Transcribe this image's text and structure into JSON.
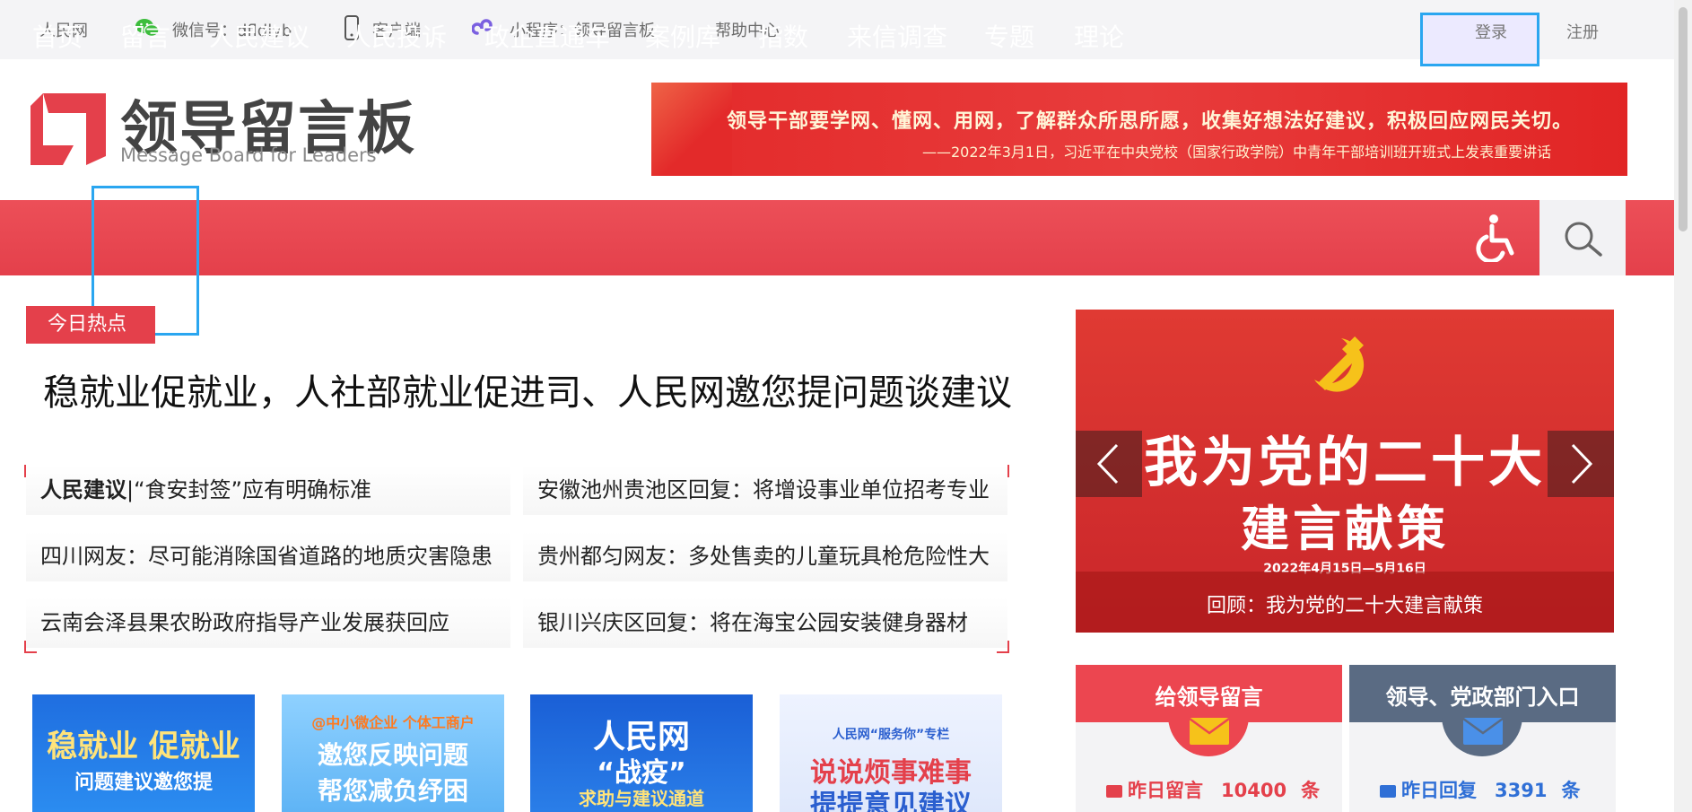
{
  "topbar": {
    "site": "人民网",
    "wechat": "微信号：dfldlyb",
    "client": "客户端",
    "miniprogram": "小程序：领导留言板",
    "help": "帮助中心",
    "login": "登录",
    "register": "注册"
  },
  "logo": {
    "cn": "领导留言板",
    "en": "Message Board for Leaders"
  },
  "banner": {
    "line1": "领导干部要学网、懂网、用网，了解群众所思所愿，收集好想法好建议，积极回应网民关切。",
    "line2": "——2022年3月1日，习近平在中央党校（国家行政学院）中青年干部培训班开班式上发表重要讲话"
  },
  "nav": {
    "items": [
      "首页",
      "留言",
      "人民建议",
      "人民投诉",
      "政企直通车",
      "案例库",
      "指数",
      "来信调查",
      "专题",
      "理论"
    ]
  },
  "hot": {
    "tag": "今日热点",
    "headline": "稳就业促就业，人社部就业促进司、人民网邀您提问题谈建议",
    "items": [
      {
        "prefix": "人民建议",
        "sep": "|",
        "text": "“食安封签”应有明确标准"
      },
      {
        "prefix": "",
        "sep": "",
        "text": "安徽池州贵池区回复：将增设事业单位招考专业"
      },
      {
        "prefix": "",
        "sep": "",
        "text": "四川网友：尽可能消除国省道路的地质灾害隐患"
      },
      {
        "prefix": "",
        "sep": "",
        "text": "贵州都匀网友：多处售卖的儿童玩具枪危险性大"
      },
      {
        "prefix": "",
        "sep": "",
        "text": "云南会泽县果农盼政府指导产业发展获回应"
      },
      {
        "prefix": "",
        "sep": "",
        "text": "银川兴庆区回复：将在海宝公园安装健身器材"
      }
    ]
  },
  "thumbs": [
    {
      "line1": "稳就业 促就业",
      "line2": "问题建议邀您提"
    },
    {
      "line0": "@中小微企业 个体工商户",
      "line1": "邀您反映问题",
      "line2": "帮您减负纾困"
    },
    {
      "line1": "人民网",
      "line2": "“战疫”",
      "line3": "求助与建议通道"
    },
    {
      "line0": "人民网“服务你”专栏",
      "line1": "说说烦事难事",
      "line2": "提提意见建议"
    }
  ],
  "carousel": {
    "line1": "我为党的二十大",
    "line2": "建言献策",
    "date": "2022年4月15日—5月16日",
    "caption": "回顾：我为党的二十大建言献策"
  },
  "entries": [
    {
      "title": "给领导留言",
      "stat_label": "昨日留言",
      "stat_value": "10400",
      "stat_unit": "条"
    },
    {
      "title": "领导、党政部门入口",
      "stat_label": "昨日回复",
      "stat_value": "3391",
      "stat_unit": "条"
    }
  ],
  "colors": {
    "brand_red": "#e4404b",
    "highlight_blue": "#2aa6f0",
    "entry2_head": "#5a6b83"
  }
}
